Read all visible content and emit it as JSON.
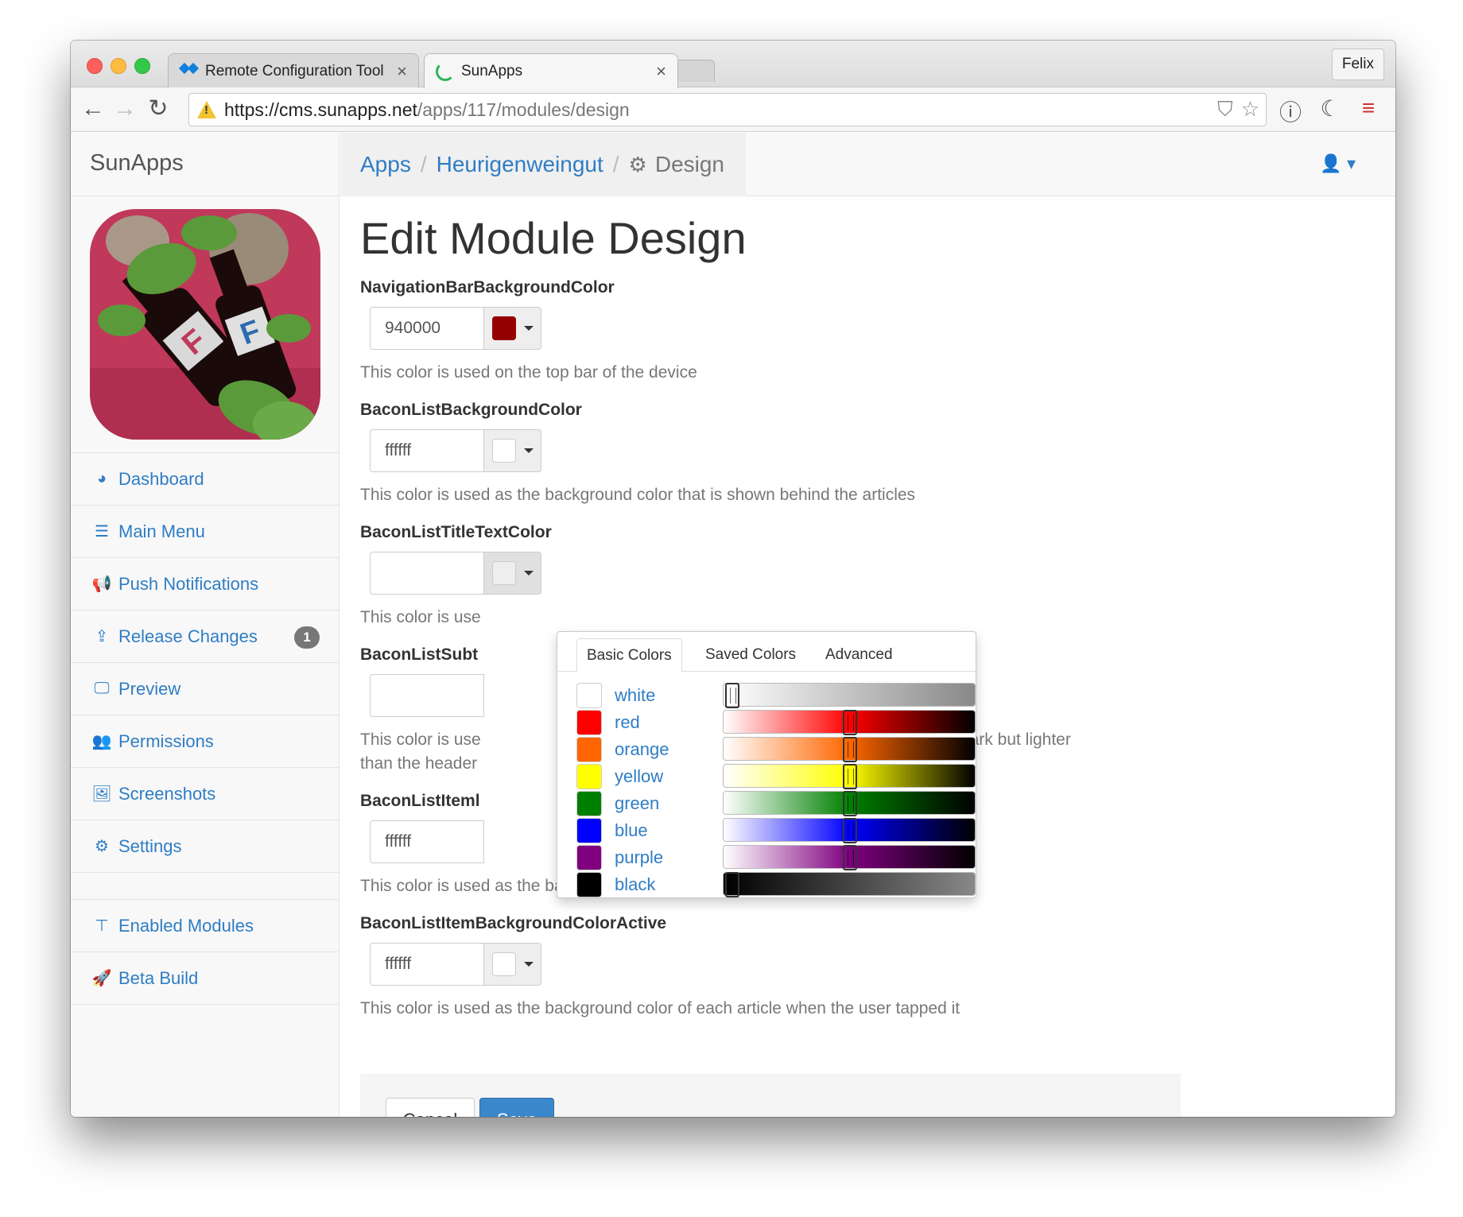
{
  "browser": {
    "tabs": [
      {
        "title": "Remote Configuration Tool",
        "icon": "dropbox-icon",
        "close": "×"
      },
      {
        "title": "SunApps",
        "icon": "loading-spinner-icon",
        "close": "×"
      }
    ],
    "profile": "Felix",
    "url": {
      "host": "https://cms.sunapps.net",
      "path": "/apps/117/modules/design"
    }
  },
  "sidebar": {
    "brand": "SunApps",
    "items": [
      {
        "label": "Dashboard",
        "icon": "dashboard-icon",
        "glyph": "◕"
      },
      {
        "label": "Main Menu",
        "icon": "list-icon",
        "glyph": "☰"
      },
      {
        "label": "Push Notifications",
        "icon": "megaphone-icon",
        "glyph": "📢"
      },
      {
        "label": "Release Changes",
        "icon": "upload-icon",
        "glyph": "⇪",
        "badge": "1"
      },
      {
        "label": "Preview",
        "icon": "monitor-icon",
        "glyph": "🖵"
      },
      {
        "label": "Permissions",
        "icon": "users-icon",
        "glyph": "👥"
      },
      {
        "label": "Screenshots",
        "icon": "image-icon",
        "glyph": "🖼"
      },
      {
        "label": "Settings",
        "icon": "cogs-icon",
        "glyph": "⚙"
      },
      {
        "label": "Enabled Modules",
        "icon": "sitemap-icon",
        "glyph": "⊤"
      },
      {
        "label": "Beta Build",
        "icon": "rocket-icon",
        "glyph": "🚀"
      }
    ]
  },
  "breadcrumb": {
    "apps": "Apps",
    "app": "Heurigenweingut",
    "current": "Design",
    "sep": "/"
  },
  "page_title": "Edit Module Design",
  "fields": [
    {
      "label": "NavigationBarBackgroundColor",
      "value": "940000",
      "swatch": "#940000",
      "help": "This color is used on the top bar of the device"
    },
    {
      "label": "BaconListBackgroundColor",
      "value": "ffffff",
      "swatch": "#ffffff",
      "help": "This color is used as the background color that is shown behind the articles"
    },
    {
      "label": "BaconListTitleTextColor",
      "value": "",
      "swatch": "#eeeeee",
      "help": "This color is use"
    },
    {
      "label": "BaconListSubt",
      "value": "",
      "swatch": "#eeeeee",
      "help": "This color is use",
      "help_right": "is value should be dark but lighter",
      "help_line2": "than the header"
    },
    {
      "label": "BaconListIteml",
      "value": "ffffff",
      "swatch": "#ffffff",
      "help": "This color is used as the background color of each article"
    },
    {
      "label": "BaconListItemBackgroundColorActive",
      "value": "ffffff",
      "swatch": "#ffffff",
      "help": "This color is used as the background color of each article when the user tapped it"
    }
  ],
  "actions": {
    "cancel": "Cancel",
    "save": "Save"
  },
  "picker": {
    "tabs": [
      "Basic Colors",
      "Saved Colors",
      "Advanced"
    ],
    "colors": [
      {
        "name": "white",
        "hex": "#ffffff",
        "level": 0.0
      },
      {
        "name": "red",
        "hex": "#ff0000",
        "level": 0.5
      },
      {
        "name": "orange",
        "hex": "#ff6600",
        "level": 0.5
      },
      {
        "name": "yellow",
        "hex": "#ffff00",
        "level": 0.5
      },
      {
        "name": "green",
        "hex": "#008000",
        "level": 0.5
      },
      {
        "name": "blue",
        "hex": "#0000ff",
        "level": 0.5
      },
      {
        "name": "purple",
        "hex": "#800080",
        "level": 0.5
      },
      {
        "name": "black",
        "hex": "#000000",
        "level": 0.0
      }
    ]
  }
}
